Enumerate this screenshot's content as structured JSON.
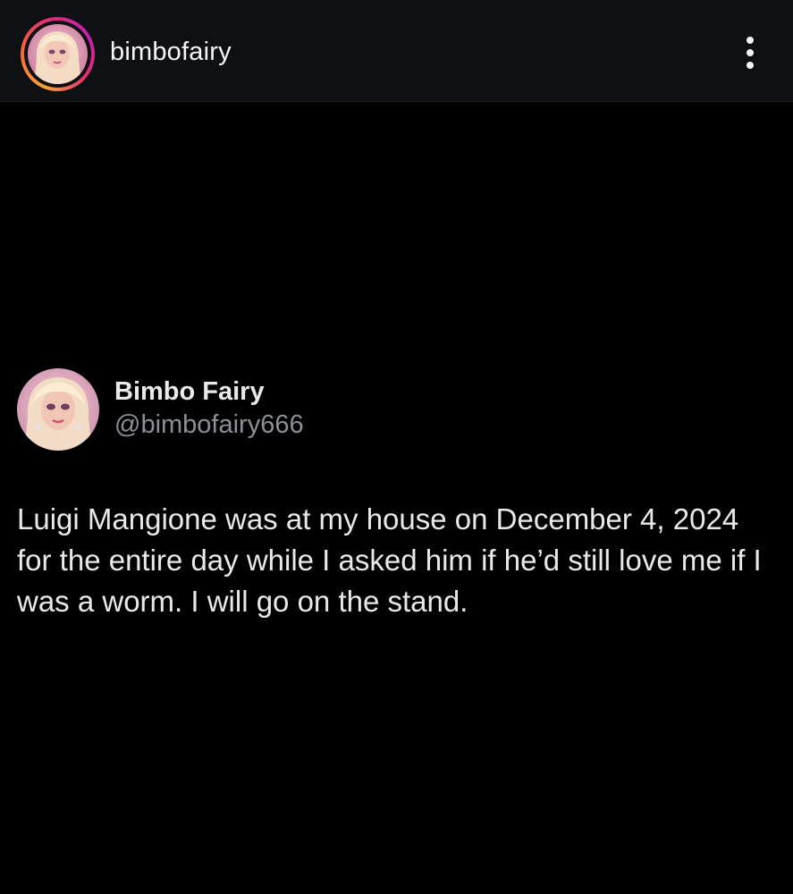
{
  "header": {
    "username": "bimbofairy",
    "more_icon": "more-vertical-icon",
    "story_ring_colors": [
      "#f9a33a",
      "#f46b2d",
      "#e32c72",
      "#c81eb0"
    ]
  },
  "tweet": {
    "display_name": "Bimbo Fairy",
    "handle": "@bimbofairy666",
    "text": "Luigi Mangione was at my house on December 4, 2024 for the entire day while I asked him if he’d still love me if I was a worm. I will go on the stand."
  },
  "colors": {
    "header_background": "#0e1013",
    "background": "#000000",
    "primary_text": "#e7e9ea",
    "secondary_text": "#8b9096"
  }
}
